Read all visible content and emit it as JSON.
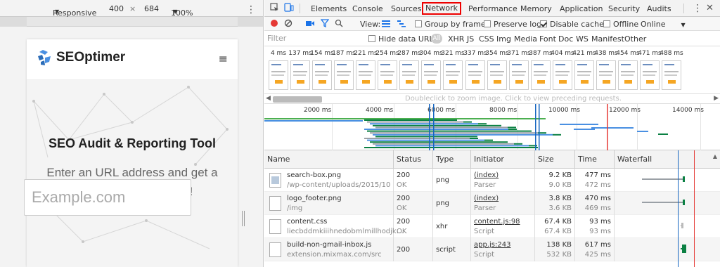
{
  "device_toolbar": {
    "mode": "Responsive",
    "width": "400",
    "times": "×",
    "height": "684",
    "zoom": "100%"
  },
  "site": {
    "logo_text": "SEOptimer",
    "hero_title": "SEO Audit & Reporting Tool",
    "hero_subtitle": "Enter an URL address and get a Free Website Analysis!",
    "input_placeholder": "Example.com"
  },
  "devtools_tabs": [
    "Elements",
    "Console",
    "Sources",
    "Network",
    "Performance",
    "Memory",
    "Application",
    "Security",
    "Audits"
  ],
  "network_toolbar": {
    "view_label": "View:",
    "group_by_frame": "Group by frame",
    "preserve_log": "Preserve log",
    "disable_cache": "Disable cache",
    "offline": "Offline",
    "throttle": "Online"
  },
  "filter": {
    "placeholder": "Filter",
    "hide_data_urls": "Hide data URLs",
    "all": "All",
    "types": [
      "XHR",
      "JS",
      "CSS",
      "Img",
      "Media",
      "Font",
      "Doc",
      "WS",
      "Manifest",
      "Other"
    ]
  },
  "filmstrip_times": [
    "4 ms",
    "137 ms",
    "154 ms",
    "187 ms",
    "221 ms",
    "254 ms",
    "287 ms",
    "304 ms",
    "321 ms",
    "337 ms",
    "354 ms",
    "371 ms",
    "387 ms",
    "404 ms",
    "421 ms",
    "438 ms",
    "454 ms",
    "471 ms",
    "488 ms"
  ],
  "scroll_hint": "Doubleclick to zoom image. Click to view preceding requests.",
  "overview_ticks": [
    "2000 ms",
    "4000 ms",
    "6000 ms",
    "8000 ms",
    "10000 ms",
    "12000 ms",
    "14000 ms"
  ],
  "columns": [
    "Name",
    "Status",
    "Type",
    "Initiator",
    "Size",
    "Time",
    "Waterfall"
  ],
  "requests": [
    {
      "name": "search-box.png",
      "path": "/wp-content/uploads/2015/10",
      "status": "200",
      "status_text": "OK",
      "type": "png",
      "initiator": "(index)",
      "initiator_sub": "Parser",
      "size": "9.2 KB",
      "size_sub": "9.0 KB",
      "time": "477 ms",
      "time_sub": "472 ms",
      "icon": "image-file-icon"
    },
    {
      "name": "logo_footer.png",
      "path": "/img",
      "status": "200",
      "status_text": "OK",
      "type": "png",
      "initiator": "(index)",
      "initiator_sub": "Parser",
      "size": "3.8 KB",
      "size_sub": "3.6 KB",
      "time": "470 ms",
      "time_sub": "469 ms",
      "icon": "file-icon"
    },
    {
      "name": "content.css",
      "path": "liecbddmkiiihnedobmlmillhodjk…",
      "status": "200",
      "status_text": "OK",
      "type": "xhr",
      "initiator": "content.js:98",
      "initiator_sub": "Script",
      "size": "67.4 KB",
      "size_sub": "67.4 KB",
      "time": "93 ms",
      "time_sub": "93 ms",
      "icon": "file-icon"
    },
    {
      "name": "build-non-gmail-inbox.js",
      "path": "extension.mixmax.com/src",
      "status": "200",
      "status_text": "",
      "type": "script",
      "initiator": "app.js:243",
      "initiator_sub": "Script",
      "size": "138 KB",
      "size_sub": "532 KB",
      "time": "617 ms",
      "time_sub": "425 ms",
      "icon": "script-file-icon"
    }
  ],
  "colors": {
    "accent_blue": "#1a73e8",
    "record_red": "#e53935",
    "load_line": "#e53935",
    "dom_line": "#1565c0",
    "bar_green": "#0b8043",
    "bar_blue": "#4a90e2"
  }
}
